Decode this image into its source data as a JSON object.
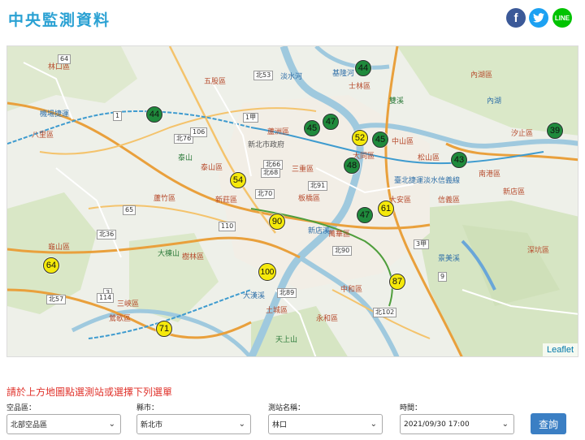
{
  "page_title": "中央監測資料",
  "social": {
    "facebook": "f",
    "twitter": "t",
    "line": "LINE"
  },
  "map": {
    "attribution": "Leaflet",
    "places": {
      "linkou_dist": "林口區",
      "wugu_dist": "五股區",
      "luzhou_dist": "蘆洲區",
      "bali_dist": "八里區",
      "taishan_dist": "泰山區",
      "xinzhuang_dist": "新莊區",
      "shulin_dist": "樹林區",
      "tucheng_dist": "土城區",
      "banqiao_dist": "板橋區",
      "zhonghe_dist": "中和區",
      "yonghe_dist": "永和區",
      "sanchong_dist": "三重區",
      "datong_dist": "大同區",
      "zhongshan_dist": "中山區",
      "daan_dist": "大安區",
      "xinyi_dist": "信義區",
      "nangang_dist": "南港區",
      "neihu_dist": "內湖區",
      "songshan_dist": "松山區",
      "shilin_dist": "士林區",
      "wanhua_dist": "萬華區",
      "xindian_dist": "新店區",
      "shenkeng_dist": "深坑區",
      "sanxia_dist": "三峽區",
      "yingge_dist": "鶯歌區",
      "guishan_dist": "龜山區",
      "luzhu_dist": "蘆竹區",
      "tamsui_river": "淡水河",
      "keelung_river": "基隆河",
      "xindian_river": "新店溪",
      "dahan_river": "大漢溪",
      "jingmei_river": "景美溪",
      "taishan_mtn": "泰山",
      "shuanxi": "雙溪",
      "tianshang": "天上山",
      "dahan_mtn": "大棟山",
      "ansin": "汐止區",
      "xinzhuang_station": "新北市政府",
      "neihu_station": "內湖",
      "mrt_label": "臺北捷運淡水信義線",
      "airport_mrt": "機場捷運"
    },
    "roads": [
      "64",
      "北76",
      "北53",
      "北66",
      "北68",
      "65",
      "北70",
      "106",
      "北89",
      "110",
      "3",
      "北91",
      "1",
      "北36",
      "114",
      "3甲",
      "北90",
      "北57",
      "北102",
      "1甲",
      "9"
    ],
    "markers": [
      {
        "value": "44",
        "level": "good"
      },
      {
        "value": "44",
        "level": "good"
      },
      {
        "value": "45",
        "level": "good"
      },
      {
        "value": "47",
        "level": "good"
      },
      {
        "value": "52",
        "level": "moderate"
      },
      {
        "value": "45",
        "level": "good"
      },
      {
        "value": "39",
        "level": "good"
      },
      {
        "value": "43",
        "level": "good"
      },
      {
        "value": "48",
        "level": "good"
      },
      {
        "value": "54",
        "level": "moderate"
      },
      {
        "value": "47",
        "level": "good"
      },
      {
        "value": "61",
        "level": "moderate"
      },
      {
        "value": "90",
        "level": "moderate"
      },
      {
        "value": "64",
        "level": "moderate"
      },
      {
        "value": "100",
        "level": "moderate"
      },
      {
        "value": "87",
        "level": "moderate"
      },
      {
        "value": "71",
        "level": "moderate"
      }
    ]
  },
  "hint": "請於上方地圖點選測站或選擇下列選單",
  "form": {
    "region_label": "空品區：",
    "region_value": "北部空品區",
    "city_label": "縣市：",
    "city_value": "新北市",
    "station_label": "測站名稱：",
    "station_value": "林口",
    "time_label": "時間：",
    "time_value": "2021/09/30 17:00",
    "query_button": "查詢"
  },
  "colors": {
    "good": "#1f8a3c",
    "moderate": "#f5e90b",
    "title": "#2aa1d3",
    "hint": "#e0322b",
    "button": "#3b7fc4"
  }
}
